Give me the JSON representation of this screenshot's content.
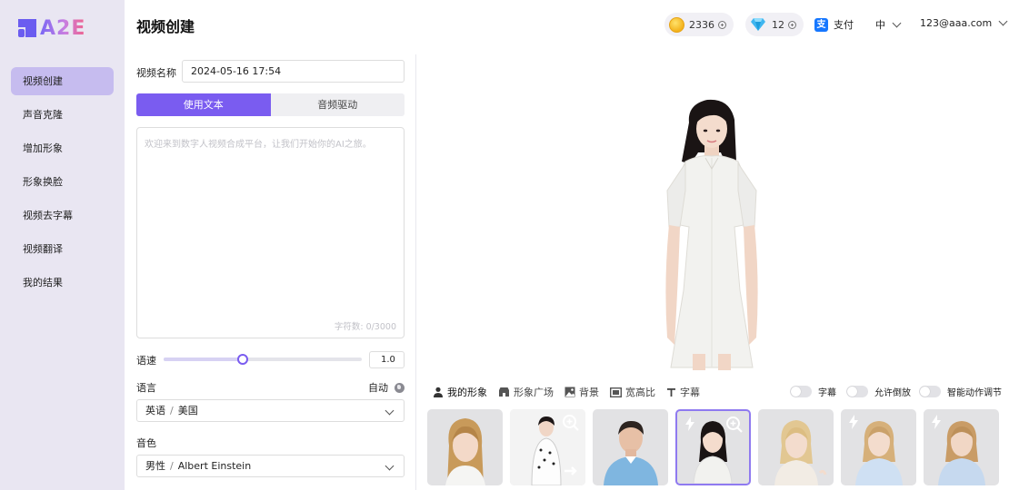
{
  "brand": {
    "name": "A2E",
    "accent": "#7a5cf0"
  },
  "sidebar": {
    "items": [
      {
        "label": "视频创建",
        "active": true
      },
      {
        "label": "声音克隆",
        "active": false
      },
      {
        "label": "增加形象",
        "active": false
      },
      {
        "label": "形象换脸",
        "active": false
      },
      {
        "label": "视频去字幕",
        "active": false
      },
      {
        "label": "视频翻译",
        "active": false
      },
      {
        "label": "我的结果",
        "active": false
      }
    ]
  },
  "header": {
    "title": "视频创建",
    "coins": "2336",
    "gems": "12",
    "pay_icon": "支",
    "pay_label": "支付",
    "language": "中",
    "user_email": "123@aaa.com"
  },
  "form": {
    "video_name_label": "视频名称",
    "video_name_value": "2024-05-16 17:54",
    "tabs": [
      {
        "label": "使用文本",
        "active": true
      },
      {
        "label": "音频驱动",
        "active": false
      }
    ],
    "text_placeholder": "欢迎来到数字人视频合成平台，让我们开始你的AI之旅。",
    "char_count": "字符数: 0/3000",
    "speed_label": "语速",
    "speed_value": "1.0",
    "speed_fraction": 0.4,
    "language_label": "语言",
    "auto_label": "自动",
    "language_select": {
      "part1": "英语",
      "sep": "/",
      "part2": "美国"
    },
    "voice_label": "音色",
    "voice_select": {
      "part1": "男性",
      "sep": "/",
      "part2": "Albert Einstein"
    }
  },
  "preview": {
    "tools": [
      {
        "label": "我的形象",
        "icon": "person-icon",
        "active": true
      },
      {
        "label": "形象广场",
        "icon": "store-icon",
        "active": false
      },
      {
        "label": "背景",
        "icon": "image-icon",
        "active": false
      },
      {
        "label": "宽高比",
        "icon": "aspect-ratio-icon",
        "active": false
      },
      {
        "label": "字幕",
        "icon": "text-icon",
        "active": false
      }
    ],
    "toggles": [
      {
        "label": "字幕",
        "on": false
      },
      {
        "label": "允许倒放",
        "on": false
      },
      {
        "label": "智能动作调节",
        "on": false
      }
    ],
    "avatars": [
      {
        "name": "avatar-blonde-braids",
        "selected": false,
        "bolt": false,
        "zoom": false
      },
      {
        "name": "avatar-presenter-dots",
        "selected": false,
        "bolt": false,
        "zoom": true
      },
      {
        "name": "avatar-man-blue-shirt",
        "selected": false,
        "bolt": false,
        "zoom": false
      },
      {
        "name": "avatar-woman-white-dress",
        "selected": true,
        "bolt": true,
        "zoom": true
      },
      {
        "name": "avatar-blonde-woman",
        "selected": false,
        "bolt": false,
        "zoom": false
      },
      {
        "name": "avatar-blonde-blue-top-1",
        "selected": false,
        "bolt": true,
        "zoom": false
      },
      {
        "name": "avatar-blonde-blue-top-2",
        "selected": false,
        "bolt": true,
        "zoom": false
      }
    ]
  }
}
